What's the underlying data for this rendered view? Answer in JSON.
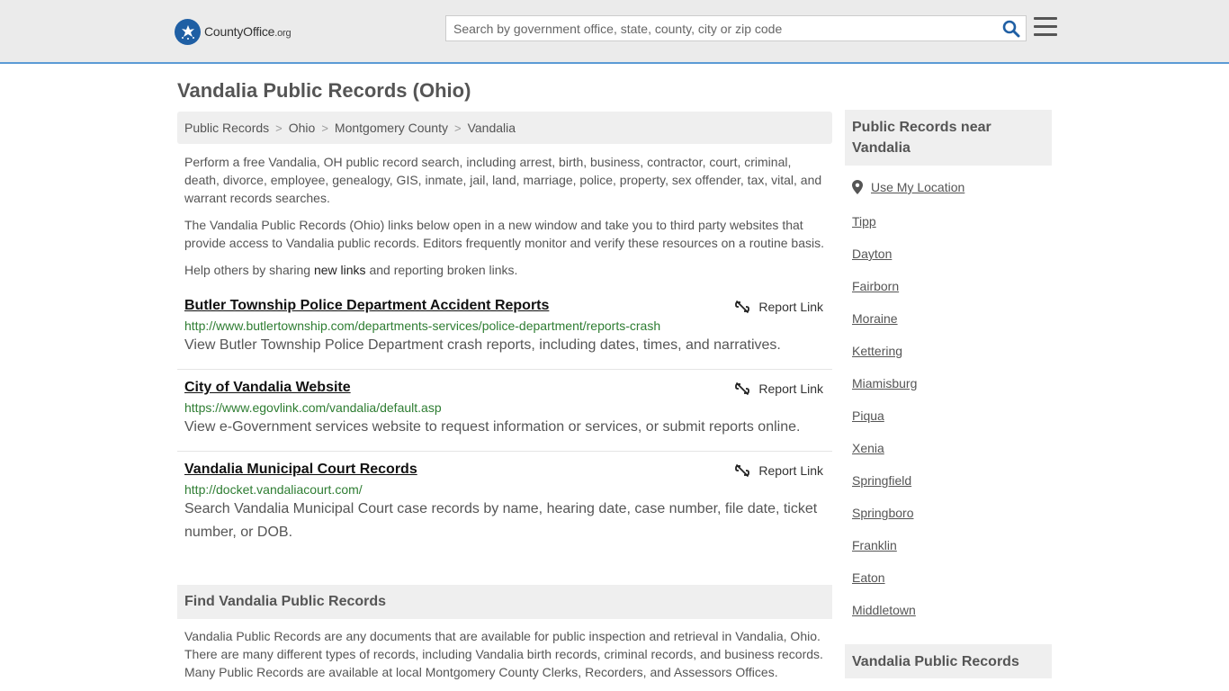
{
  "brand": {
    "name_main": "CountyOffice",
    "name_suffix": ".org",
    "color": "#1f5fa4"
  },
  "search": {
    "placeholder": "Search by government office, state, county, city or zip code",
    "value": ""
  },
  "page": {
    "title": "Vandalia Public Records (Ohio)"
  },
  "breadcrumb": [
    {
      "label": "Public Records"
    },
    {
      "label": "Ohio"
    },
    {
      "label": "Montgomery County"
    },
    {
      "label": "Vandalia"
    }
  ],
  "intro": {
    "p1": "Perform a free Vandalia, OH public record search, including arrest, birth, business, contractor, court, criminal, death, divorce, employee, genealogy, GIS, inmate, jail, land, marriage, police, property, sex offender, tax, vital, and warrant records searches.",
    "p2": "The Vandalia Public Records (Ohio) links below open in a new window and take you to third party websites that provide access to Vandalia public records. Editors frequently monitor and verify these resources on a routine basis.",
    "p3_before": "Help others by sharing ",
    "p3_link": "new links",
    "p3_after": " and reporting broken links."
  },
  "records": [
    {
      "title": "Butler Township Police Department Accident Reports",
      "url": "http://www.butlertownship.com/departments-services/police-department/reports-crash",
      "description": "View Butler Township Police Department crash reports, including dates, times, and narratives.",
      "report_label": "Report Link"
    },
    {
      "title": "City of Vandalia Website",
      "url": "https://www.egovlink.com/vandalia/default.asp",
      "description": "View e-Government services website to request information or services, or submit reports online.",
      "report_label": "Report Link"
    },
    {
      "title": "Vandalia Municipal Court Records",
      "url": "http://docket.vandaliacourt.com/",
      "description": "Search Vandalia Municipal Court case records by name, hearing date, case number, file date, ticket number, or DOB.",
      "report_label": "Report Link"
    }
  ],
  "find_section": {
    "heading": "Find Vandalia Public Records",
    "body": "Vandalia Public Records are any documents that are available for public inspection and retrieval in Vandalia, Ohio. There are many different types of records, including Vandalia birth records, criminal records, and business records. Many Public Records are available at local Montgomery County Clerks, Recorders, and Assessors Offices."
  },
  "sidebar": {
    "near_heading": "Public Records near Vandalia",
    "use_location": "Use My Location",
    "near_places": [
      "Tipp",
      "Dayton",
      "Fairborn",
      "Moraine",
      "Kettering",
      "Miamisburg",
      "Piqua",
      "Xenia",
      "Springfield",
      "Springboro",
      "Franklin",
      "Eaton",
      "Middletown"
    ],
    "second_heading": "Vandalia Public Records"
  },
  "icons": {
    "search": "search-icon",
    "menu": "hamburger-menu-icon",
    "report": "broken-link-icon",
    "location": "map-pin-icon"
  },
  "colors": {
    "accent_border": "#5b9bd5",
    "url_green": "#2e7d32",
    "search_icon": "#1f5fa4"
  }
}
